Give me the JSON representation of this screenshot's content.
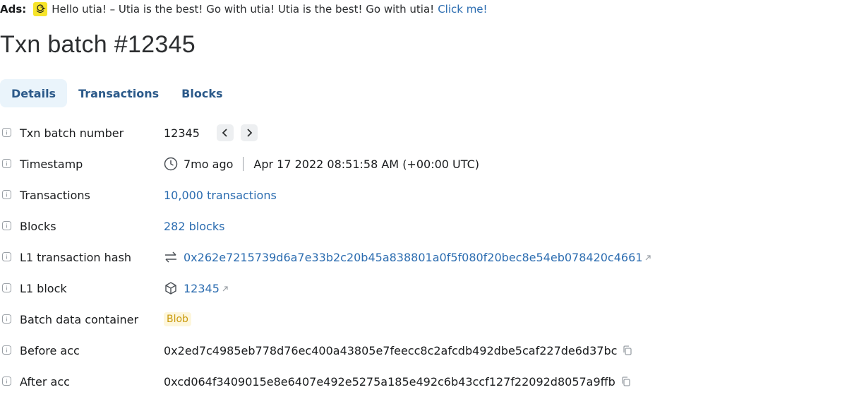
{
  "ads": {
    "label": "Ads:",
    "logo_icon": "duck-icon",
    "text": "Hello utia! – Utia is the best! Go with utia! Utia is the best! Go with utia!",
    "link": "Click me!"
  },
  "page": {
    "title": "Txn batch #12345"
  },
  "tabs": [
    {
      "label": "Details",
      "active": true
    },
    {
      "label": "Transactions",
      "active": false
    },
    {
      "label": "Blocks",
      "active": false
    }
  ],
  "details": {
    "batch_number": {
      "label": "Txn batch number",
      "value": "12345"
    },
    "timestamp": {
      "label": "Timestamp",
      "relative": "7mo ago",
      "absolute": "Apr 17 2022 08:51:58 AM (+00:00 UTC)"
    },
    "transactions": {
      "label": "Transactions",
      "value": "10,000 transactions"
    },
    "blocks": {
      "label": "Blocks",
      "value": "282 blocks"
    },
    "l1_tx_hash": {
      "label": "L1 transaction hash",
      "value": "0x262e7215739d6a7e33b2c20b45a838801a0f5f080f20bec8e54eb078420c4661"
    },
    "l1_block": {
      "label": "L1 block",
      "value": "12345"
    },
    "container": {
      "label": "Batch data container",
      "value": "Blob"
    },
    "before_acc": {
      "label": "Before acc",
      "value": "0x2ed7c4985eb778d76ec400a43805e7feecc8c2afcdb492dbe5caf227de6d37bc"
    },
    "after_acc": {
      "label": "After acc",
      "value": "0xcd064f3409015e8e6407e492e5275a185e492c6b43ccf127f22092d8057a9ffb"
    }
  },
  "colors": {
    "link": "#2b6cb0",
    "tab_active_bg": "#eaf4fb",
    "blob_bg": "#fdf6dc",
    "blob_text": "#c99a0c"
  }
}
